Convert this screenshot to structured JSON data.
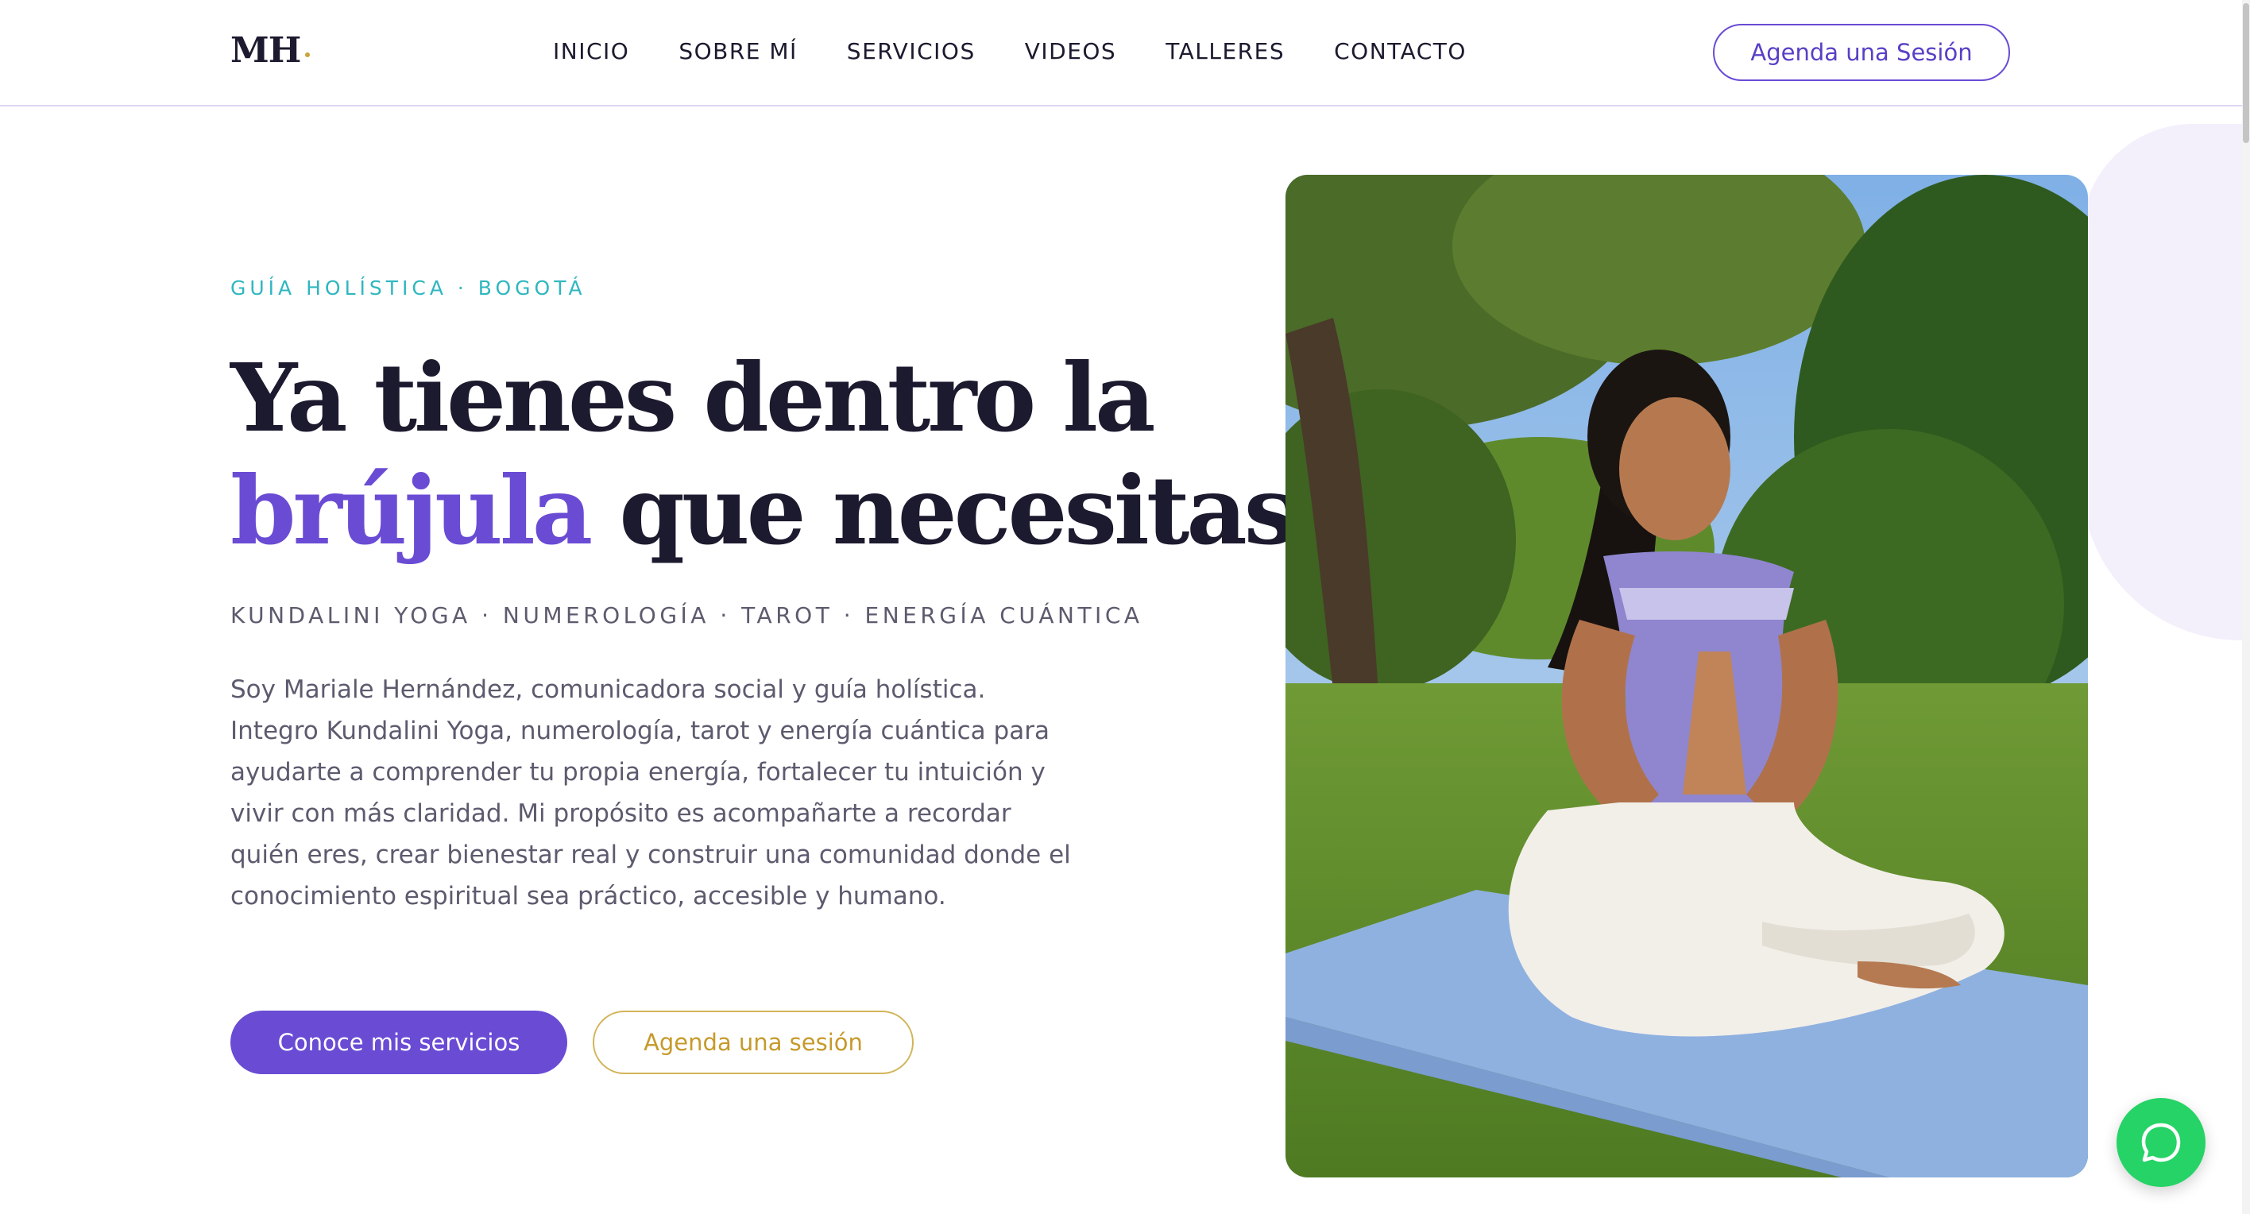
{
  "header": {
    "logo": "MH",
    "nav": [
      "INICIO",
      "SOBRE MÍ",
      "SERVICIOS",
      "VIDEOS",
      "TALLERES",
      "CONTACTO"
    ],
    "cta": "Agenda una Sesión"
  },
  "hero": {
    "eyebrow": "GUÍA HOLÍSTICA · BOGOTÁ",
    "headline_line1": "Ya tienes dentro la",
    "headline_accent": "brújula",
    "headline_line2_rest": " que necesitas.",
    "tags": "KUNDALINI YOGA · NUMEROLOGÍA · TAROT · ENERGÍA CUÁNTICA",
    "bio": "Soy Mariale Hernández, comunicadora social y guía holística. Integro Kundalini Yoga, numerología, tarot y energía cuántica para ayudarte a comprender tu propia energía, fortalecer tu intuición y vivir con más claridad. Mi propósito es acompañarte a recordar quién eres, crear bienestar real y construir una comunidad donde el conocimiento espiritual sea práctico, accesible y humano.",
    "primary_button": "Conoce mis servicios",
    "secondary_button": "Agenda una sesión"
  },
  "icons": {
    "whatsapp": "whatsapp-icon"
  },
  "colors": {
    "accent_purple": "#6a4bd4",
    "eyebrow_teal": "#2fb7c0",
    "gold": "#c69a2b",
    "whatsapp_green": "#25d366"
  }
}
